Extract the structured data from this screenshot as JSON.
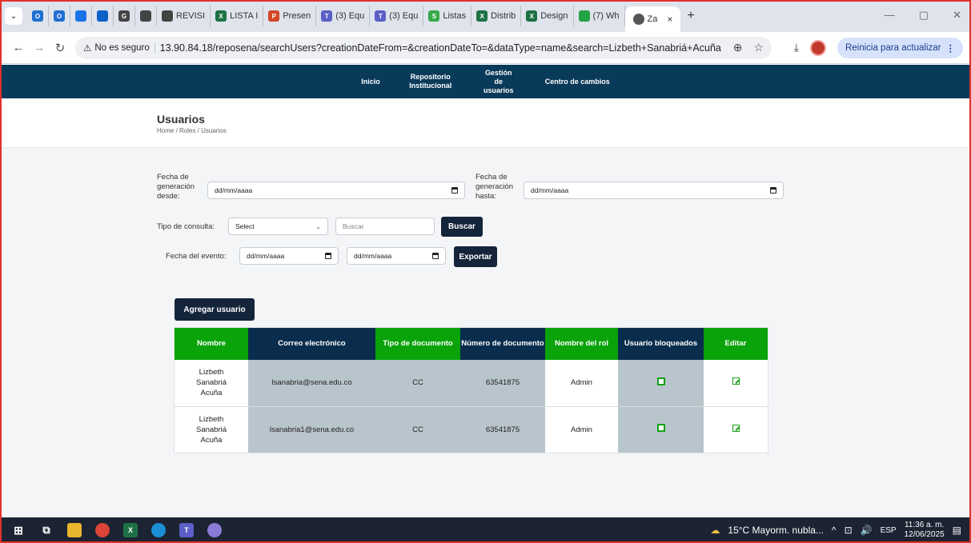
{
  "browser": {
    "tabs": [
      {
        "label": "",
        "color": "#1f6fd1",
        "glyph": "O"
      },
      {
        "label": "",
        "color": "#1f6fd1",
        "glyph": "O"
      },
      {
        "label": "",
        "color": "#1a73e8",
        "glyph": ""
      },
      {
        "label": "",
        "color": "#0b61c8",
        "glyph": ""
      },
      {
        "label": "",
        "color": "#444444",
        "glyph": "G"
      },
      {
        "label": "",
        "color": "#444444",
        "glyph": ""
      },
      {
        "label": "REVISI",
        "color": "#444444",
        "glyph": ""
      },
      {
        "label": "LISTA I",
        "color": "#1e7145",
        "glyph": "X"
      },
      {
        "label": "Presen",
        "color": "#d24726",
        "glyph": "P"
      },
      {
        "label": "(3) Equ",
        "color": "#5b5fc7",
        "glyph": "T"
      },
      {
        "label": "(3) Equ",
        "color": "#5b5fc7",
        "glyph": "T"
      },
      {
        "label": "Listas",
        "color": "#36a94a",
        "glyph": "S"
      },
      {
        "label": "Distrib",
        "color": "#1e7145",
        "glyph": "X"
      },
      {
        "label": "Design",
        "color": "#1e7145",
        "glyph": "X"
      },
      {
        "label": "(7) Wh",
        "color": "#25a244",
        "glyph": ""
      }
    ],
    "active_tab": {
      "label": "Za",
      "close": "×"
    },
    "new_tab": "+",
    "window_controls": [
      "—",
      "▢",
      "✕"
    ],
    "security_label": "No es seguro",
    "url": "13.90.84.18/reposena/searchUsers?creationDateFrom=&creationDateTo=&dataType=name&search=Lizbeth+Sanabriá+Acuña",
    "update_button": "Reinicia para actualizar"
  },
  "nav": {
    "items": [
      "Inicio",
      "Repositorio Institucional",
      "Gestión de usuarios",
      "Centro de cambios"
    ]
  },
  "header": {
    "title": "Usuarios",
    "breadcrumb": "Home / Roles / Usuarios"
  },
  "filters": {
    "date_from_label": "Fecha de generación desde:",
    "date_from_value": "dd/mm/aaaa",
    "date_to_label": "Fecha de generación hasta:",
    "date_to_value": "dd/mm/aaaa",
    "query_type_label": "Tipo de consulta:",
    "query_type_value": "Select",
    "search_placeholder": "Buscar",
    "search_button": "Buscar",
    "event_date_label": "Fecha del evento:",
    "event_date_from": "dd/mm/aaaa",
    "event_date_to": "dd/mm/aaaa",
    "export_button": "Exportar"
  },
  "add_user_button": "Agregar usuario",
  "table": {
    "headers": [
      "Nombre",
      "Correo electrónico",
      "Tipo de documento",
      "Número de documento",
      "Nombre del rol",
      "Usuario bloqueados",
      "Editar"
    ],
    "rows": [
      {
        "name": "Lizbeth Sanabriá Acuña",
        "email": "lsanabria@sena.edu.co",
        "doc_type": "CC",
        "doc_number": "63541875",
        "role": "Admin",
        "blocked": false
      },
      {
        "name": "Lizbeth Sanabriá Acuña",
        "email": "lsanabria1@sena.edu.co",
        "doc_type": "CC",
        "doc_number": "63541875",
        "role": "Admin",
        "blocked": false
      }
    ]
  },
  "taskbar": {
    "weather": "15°C  Mayorm. nubla...",
    "language": "ESP",
    "time": "11:36 a. m.",
    "date": "12/06/2025"
  }
}
